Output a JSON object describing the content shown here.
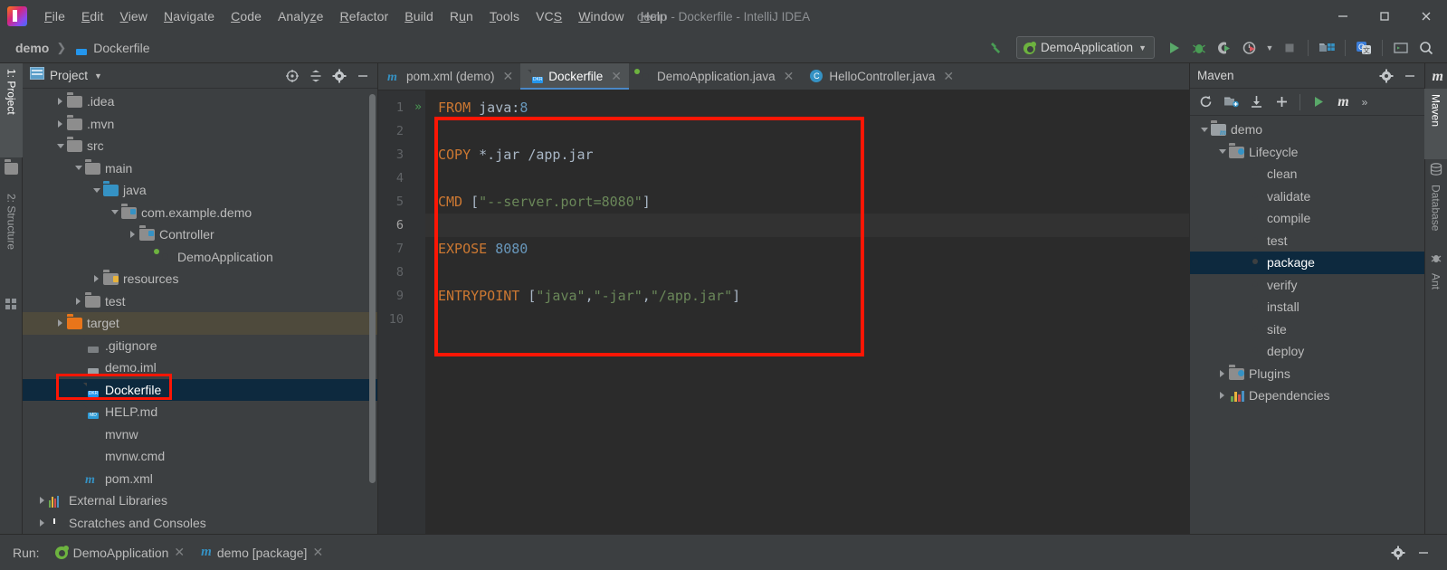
{
  "window": {
    "title": "demo - Dockerfile - IntelliJ IDEA",
    "logo_icon": "intellij-idea-logo",
    "minimize_label": "—",
    "maximize_label": "❐",
    "close_label": "✕"
  },
  "menubar": {
    "items": [
      {
        "label": "File",
        "mnemonic": "F"
      },
      {
        "label": "Edit",
        "mnemonic": "E"
      },
      {
        "label": "View",
        "mnemonic": "V"
      },
      {
        "label": "Navigate",
        "mnemonic": "N"
      },
      {
        "label": "Code",
        "mnemonic": "C"
      },
      {
        "label": "Analyze",
        "mnemonic": "z"
      },
      {
        "label": "Refactor",
        "mnemonic": "R"
      },
      {
        "label": "Build",
        "mnemonic": "B"
      },
      {
        "label": "Run",
        "mnemonic": "u"
      },
      {
        "label": "Tools",
        "mnemonic": "T"
      },
      {
        "label": "VCS",
        "mnemonic": "S"
      },
      {
        "label": "Window",
        "mnemonic": "W"
      },
      {
        "label": "Help",
        "mnemonic": "H"
      }
    ]
  },
  "navbar": {
    "breadcrumbs": [
      {
        "label": "demo",
        "icon": "project-icon"
      },
      {
        "label": "Dockerfile",
        "icon": "dockerfile-icon"
      }
    ],
    "build_icon": "hammer-icon",
    "run_config": {
      "label": "DemoApplication",
      "icon": "spring-boot-icon",
      "dropdown_icon": "chevron-down-icon"
    },
    "buttons": [
      {
        "name": "run-button",
        "icon": "play-icon",
        "label": "Run"
      },
      {
        "name": "debug-button",
        "icon": "bug-icon",
        "label": "Debug"
      },
      {
        "name": "run-coverage-button",
        "icon": "coverage-icon",
        "label": "Run with Coverage"
      },
      {
        "name": "profile-button",
        "icon": "profiler-icon",
        "label": "Profile"
      },
      {
        "name": "profile-dropdown",
        "icon": "chevron-down-icon",
        "label": ""
      },
      {
        "name": "stop-button",
        "icon": "stop-icon",
        "label": "Stop"
      },
      {
        "name": "project-structure-button",
        "icon": "project-structure-icon",
        "label": "Project Structure"
      },
      {
        "name": "translate-button",
        "icon": "translate-icon",
        "label": "Translate"
      },
      {
        "name": "terminal-button",
        "icon": "terminal-icon",
        "label": "Terminal"
      },
      {
        "name": "search-everywhere-button",
        "icon": "search-icon",
        "label": "Search Everywhere"
      }
    ]
  },
  "left_strip": {
    "tabs": [
      {
        "label": "1: Project",
        "icon": "project-folder-icon",
        "active": true
      },
      {
        "label": "2: Structure",
        "icon": "structure-icon",
        "active": false
      }
    ]
  },
  "right_strip": {
    "tabs": [
      {
        "label": "Maven",
        "icon": "maven-m-icon",
        "active": true
      },
      {
        "label": "Database",
        "icon": "database-icon",
        "active": false
      },
      {
        "label": "Ant",
        "icon": "ant-icon",
        "active": false
      }
    ]
  },
  "project_panel": {
    "title": "Project",
    "view_icon": "project-view-icon",
    "dropdown_icon": "chevron-down-icon",
    "header_buttons": [
      {
        "name": "locate-button",
        "icon": "crosshair-icon"
      },
      {
        "name": "collapse-all-button",
        "icon": "collapse-all-icon"
      },
      {
        "name": "settings-button",
        "icon": "gear-icon"
      },
      {
        "name": "hide-button",
        "icon": "minus-icon"
      }
    ],
    "tree": [
      {
        "label": ".idea",
        "indent": 1,
        "twist": "right",
        "icon": "folder",
        "state": "normal"
      },
      {
        "label": ".mvn",
        "indent": 1,
        "twist": "right",
        "icon": "folder",
        "state": "normal"
      },
      {
        "label": "src",
        "indent": 1,
        "twist": "down",
        "icon": "folder",
        "state": "normal"
      },
      {
        "label": "main",
        "indent": 2,
        "twist": "down",
        "icon": "folder",
        "state": "normal"
      },
      {
        "label": "java",
        "indent": 3,
        "twist": "down",
        "icon": "folder-blue",
        "state": "normal"
      },
      {
        "label": "com.example.demo",
        "indent": 4,
        "twist": "down",
        "icon": "package",
        "state": "normal"
      },
      {
        "label": "Controller",
        "indent": 5,
        "twist": "right",
        "icon": "package",
        "state": "normal"
      },
      {
        "label": "DemoApplication",
        "indent": 6,
        "twist": "none",
        "icon": "spring",
        "state": "normal"
      },
      {
        "label": "resources",
        "indent": 3,
        "twist": "right",
        "icon": "resources",
        "state": "normal"
      },
      {
        "label": "test",
        "indent": 2,
        "twist": "right",
        "icon": "folder",
        "state": "normal"
      },
      {
        "label": "target",
        "indent": 1,
        "twist": "right",
        "icon": "folder-orange",
        "state": "highlight"
      },
      {
        "label": ".gitignore",
        "indent": 2,
        "twist": "none",
        "icon": "file-git",
        "state": "normal"
      },
      {
        "label": "demo.iml",
        "indent": 2,
        "twist": "none",
        "icon": "file-iml",
        "state": "normal"
      },
      {
        "label": "Dockerfile",
        "indent": 2,
        "twist": "none",
        "icon": "file-docker",
        "state": "selected"
      },
      {
        "label": "HELP.md",
        "indent": 2,
        "twist": "none",
        "icon": "file-md",
        "state": "normal"
      },
      {
        "label": "mvnw",
        "indent": 2,
        "twist": "none",
        "icon": "file-sh",
        "state": "normal"
      },
      {
        "label": "mvnw.cmd",
        "indent": 2,
        "twist": "none",
        "icon": "file-cmd",
        "state": "normal"
      },
      {
        "label": "pom.xml",
        "indent": 2,
        "twist": "none",
        "icon": "file-maven",
        "state": "normal"
      },
      {
        "label": "External Libraries",
        "indent": 0,
        "twist": "right",
        "icon": "libraries",
        "state": "normal"
      },
      {
        "label": "Scratches and Consoles",
        "indent": 0,
        "twist": "right",
        "icon": "scratches",
        "state": "normal"
      }
    ]
  },
  "editor": {
    "tabs": [
      {
        "label": "pom.xml (demo)",
        "icon": "maven-file-icon",
        "active": false,
        "close": "✕"
      },
      {
        "label": "Dockerfile",
        "icon": "docker-file-icon",
        "active": true,
        "close": "✕"
      },
      {
        "label": "DemoApplication.java",
        "icon": "spring-boot-icon",
        "active": false,
        "close": "✕"
      },
      {
        "label": "HelloController.java",
        "icon": "java-class-icon",
        "active": false,
        "close": "✕"
      }
    ],
    "gutter_lines": [
      "1",
      "2",
      "3",
      "4",
      "5",
      "6",
      "7",
      "8",
      "9",
      "10"
    ],
    "current_line": 6,
    "run_gutter_icon": "run-line-icon",
    "inspection_status_icon": "ok-check-icon",
    "code_lines": [
      {
        "n": 1,
        "tokens": [
          {
            "t": "FROM",
            "c": "kw"
          },
          {
            "t": " java",
            "c": "txt"
          },
          {
            "t": ":",
            "c": "punct"
          },
          {
            "t": "8",
            "c": "num"
          }
        ]
      },
      {
        "n": 2,
        "tokens": []
      },
      {
        "n": 3,
        "tokens": [
          {
            "t": "COPY",
            "c": "kw"
          },
          {
            "t": " *.jar /app.jar",
            "c": "txt"
          }
        ]
      },
      {
        "n": 4,
        "tokens": []
      },
      {
        "n": 5,
        "tokens": [
          {
            "t": "CMD",
            "c": "kw"
          },
          {
            "t": " [",
            "c": "punct"
          },
          {
            "t": "\"--server.port=8080\"",
            "c": "str"
          },
          {
            "t": "]",
            "c": "punct"
          }
        ]
      },
      {
        "n": 6,
        "tokens": []
      },
      {
        "n": 7,
        "tokens": [
          {
            "t": "EXPOSE",
            "c": "kw"
          },
          {
            "t": " ",
            "c": "txt"
          },
          {
            "t": "8080",
            "c": "num"
          }
        ]
      },
      {
        "n": 8,
        "tokens": []
      },
      {
        "n": 9,
        "tokens": [
          {
            "t": "ENTRYPOINT",
            "c": "kw"
          },
          {
            "t": " [",
            "c": "punct"
          },
          {
            "t": "\"java\"",
            "c": "str"
          },
          {
            "t": ",",
            "c": "punct"
          },
          {
            "t": "\"-jar\"",
            "c": "str"
          },
          {
            "t": ",",
            "c": "punct"
          },
          {
            "t": "\"/app.jar\"",
            "c": "str"
          },
          {
            "t": "]",
            "c": "punct"
          }
        ]
      },
      {
        "n": 10,
        "tokens": []
      }
    ]
  },
  "annotations": {
    "code_box_color": "#fc1605",
    "tree_box_color": "#fc1605"
  },
  "maven_panel": {
    "title": "Maven",
    "header_buttons": [
      {
        "name": "maven-settings-button",
        "icon": "gear-icon"
      },
      {
        "name": "maven-hide-button",
        "icon": "minus-icon"
      }
    ],
    "toolbar_buttons": [
      {
        "name": "reload-projects-button",
        "icon": "refresh-icon"
      },
      {
        "name": "add-maven-project-button",
        "icon": "folder-add-icon"
      },
      {
        "name": "download-sources-button",
        "icon": "download-icon"
      },
      {
        "name": "add-button",
        "icon": "plus-icon"
      },
      {
        "name": "execute-goal-button",
        "icon": "play-icon"
      },
      {
        "name": "maven-goal-button",
        "icon": "maven-m-icon"
      },
      {
        "name": "more-button",
        "icon": "chevron-right-double-icon"
      }
    ],
    "tree": [
      {
        "label": "demo",
        "indent": 0,
        "twist": "down",
        "icon": "maven-project",
        "state": "normal"
      },
      {
        "label": "Lifecycle",
        "indent": 1,
        "twist": "down",
        "icon": "lifecycle",
        "state": "normal"
      },
      {
        "label": "clean",
        "indent": 2,
        "twist": "none",
        "icon": "goal",
        "state": "normal"
      },
      {
        "label": "validate",
        "indent": 2,
        "twist": "none",
        "icon": "goal",
        "state": "normal"
      },
      {
        "label": "compile",
        "indent": 2,
        "twist": "none",
        "icon": "goal",
        "state": "normal"
      },
      {
        "label": "test",
        "indent": 2,
        "twist": "none",
        "icon": "goal",
        "state": "normal"
      },
      {
        "label": "package",
        "indent": 2,
        "twist": "none",
        "icon": "goal",
        "state": "selected"
      },
      {
        "label": "verify",
        "indent": 2,
        "twist": "none",
        "icon": "goal",
        "state": "normal"
      },
      {
        "label": "install",
        "indent": 2,
        "twist": "none",
        "icon": "goal",
        "state": "normal"
      },
      {
        "label": "site",
        "indent": 2,
        "twist": "none",
        "icon": "goal",
        "state": "normal"
      },
      {
        "label": "deploy",
        "indent": 2,
        "twist": "none",
        "icon": "goal",
        "state": "normal"
      },
      {
        "label": "Plugins",
        "indent": 1,
        "twist": "right",
        "icon": "plugins",
        "state": "normal"
      },
      {
        "label": "Dependencies",
        "indent": 1,
        "twist": "right",
        "icon": "dependencies",
        "state": "normal"
      }
    ]
  },
  "bottom_bar": {
    "run_label": "Run:",
    "tabs": [
      {
        "label": "DemoApplication",
        "icon": "spring-boot-icon",
        "close": "✕"
      },
      {
        "label": "demo [package]",
        "icon": "maven-m-icon",
        "close": "✕"
      }
    ],
    "buttons": [
      {
        "name": "run-settings-button",
        "icon": "gear-icon"
      },
      {
        "name": "run-hide-button",
        "icon": "minus-icon"
      }
    ]
  },
  "colors": {
    "bg_chrome": "#3c3f41",
    "bg_editor": "#2b2b2b",
    "selection": "#0d293e",
    "accent_blue": "#3592c4",
    "keyword_orange": "#cc7832",
    "string_green": "#6a8759",
    "number_blue": "#6897bb",
    "annotation_red": "#fc1605"
  }
}
